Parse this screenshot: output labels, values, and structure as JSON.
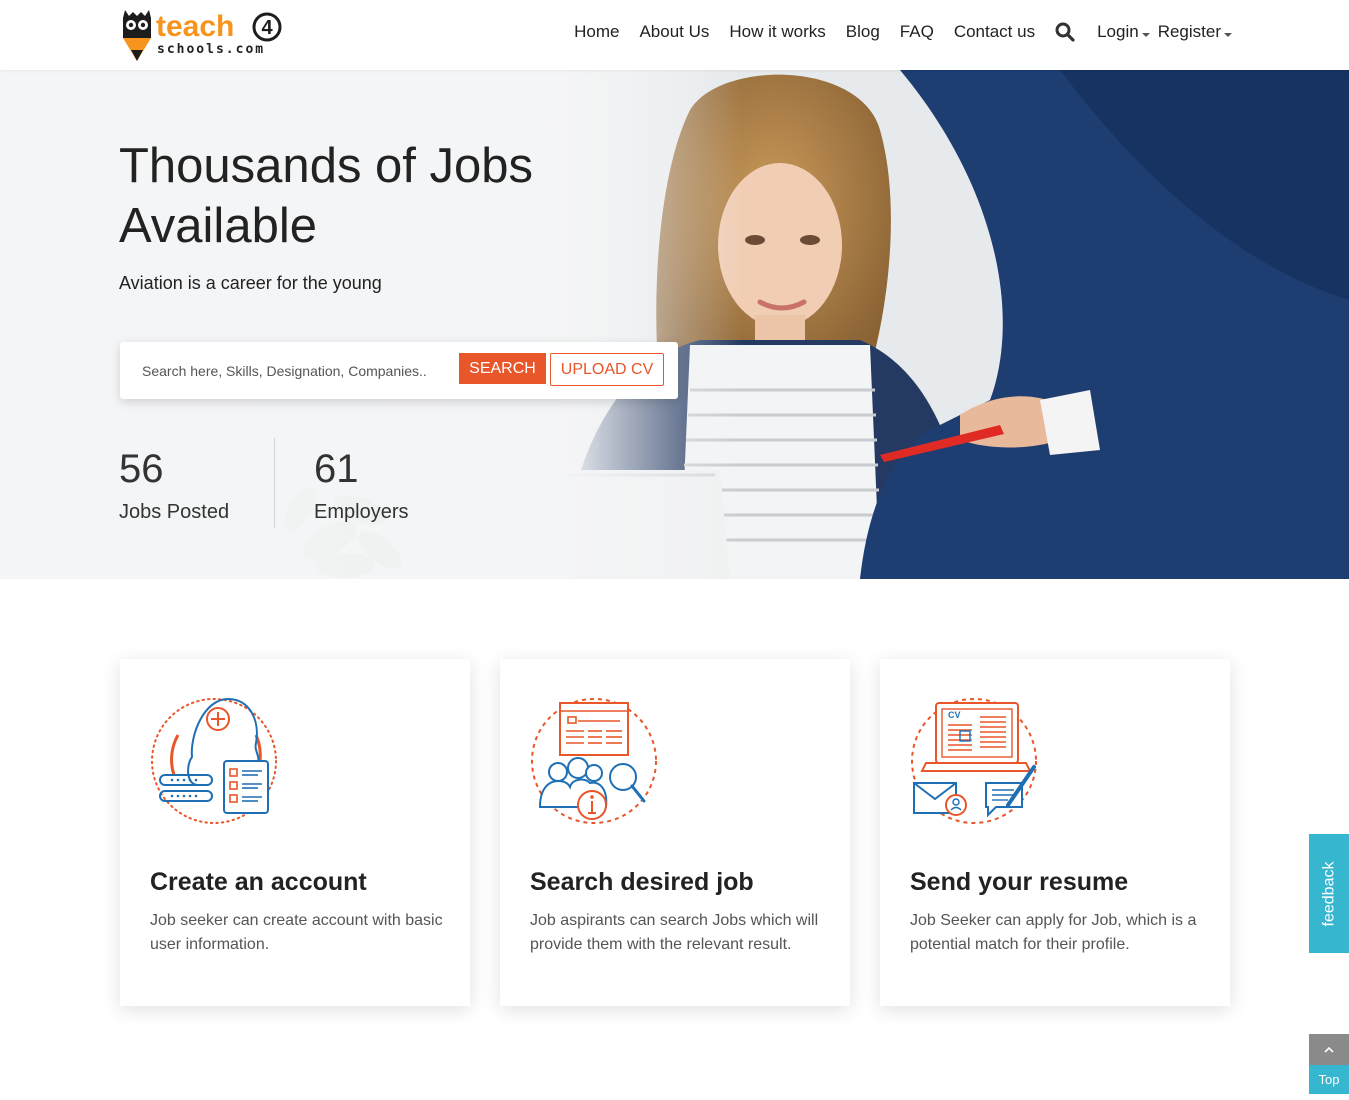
{
  "brand": {
    "name_part1": "teach",
    "name_badge": "4",
    "name_part2": "schools.com"
  },
  "nav": {
    "items": [
      "Home",
      "About Us",
      "How it works",
      "Blog",
      "FAQ",
      "Contact us"
    ],
    "login": "Login",
    "register": "Register"
  },
  "hero": {
    "title": "Thousands of Jobs Available",
    "subtitle": "Aviation is a career for the young",
    "search_placeholder": "Search here, Skills, Designation, Companies..",
    "search_button": "SEARCH",
    "upload_button": "UPLOAD CV",
    "stats": [
      {
        "value": "56",
        "label": "Jobs Posted"
      },
      {
        "value": "61",
        "label": "Employers"
      }
    ]
  },
  "cards": [
    {
      "title": "Create an account",
      "desc": "Job seeker can create account with basic user information."
    },
    {
      "title": "Search desired job",
      "desc": "Job aspirants can search Jobs which will provide them with the relevant result."
    },
    {
      "title": "Send your resume",
      "desc": "Job Seeker can apply for Job, which is a potential match for their profile."
    }
  ],
  "widgets": {
    "feedback": "feedback",
    "top": "Top"
  },
  "colors": {
    "accent": "#e8562a",
    "brand_orange": "#f7941d",
    "icon_blue": "#1f6fb5",
    "widget_cyan": "#37b6d0"
  }
}
